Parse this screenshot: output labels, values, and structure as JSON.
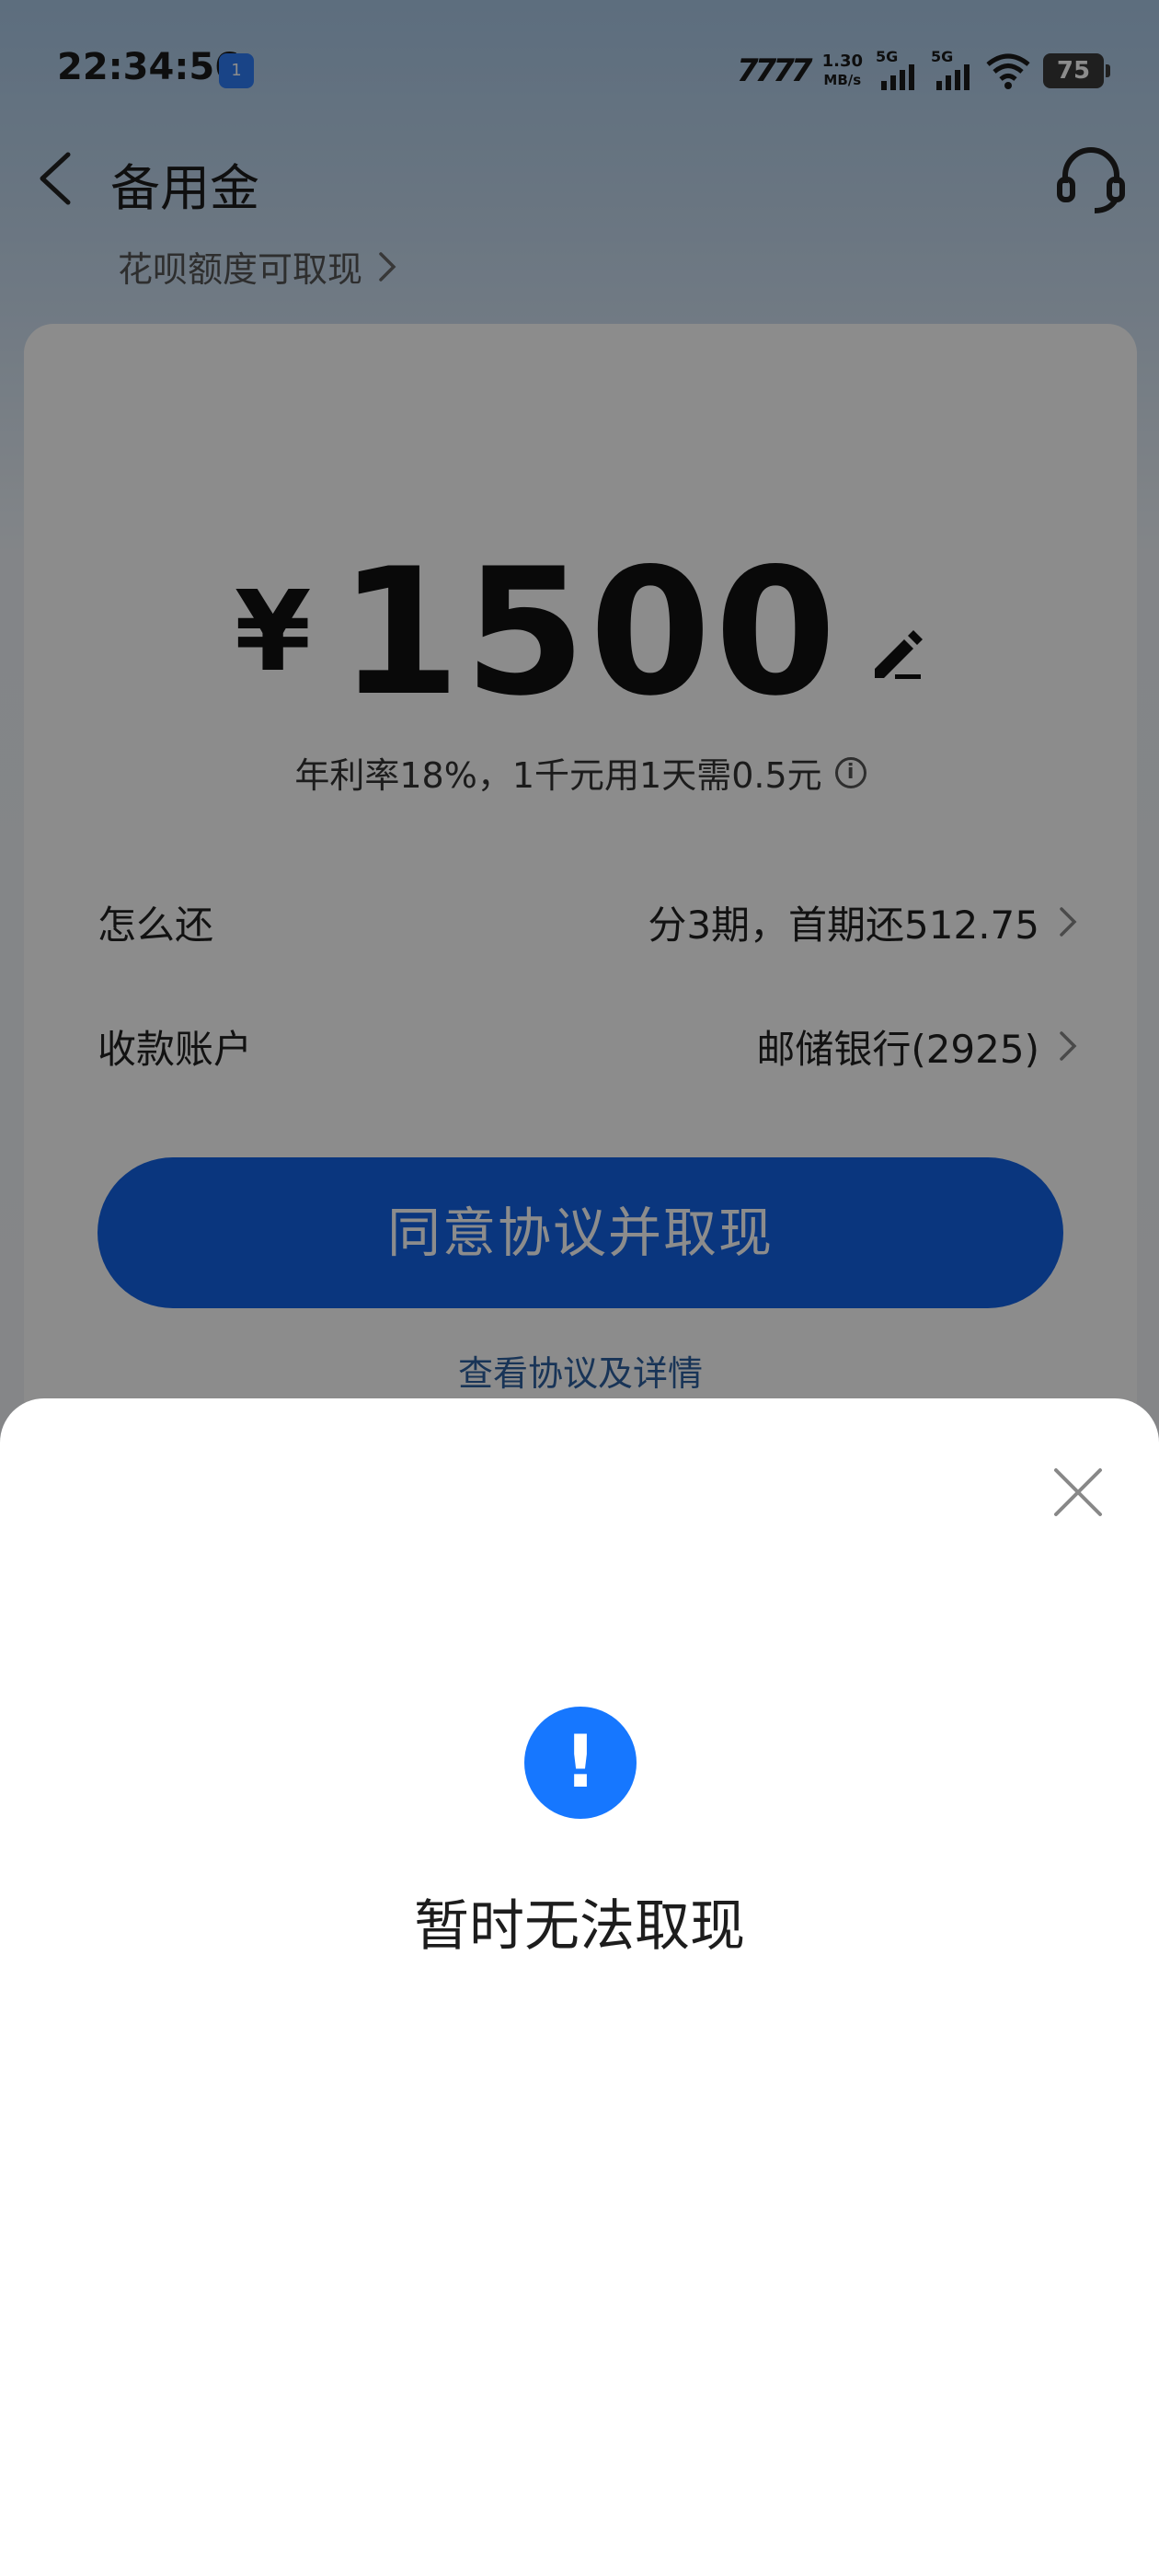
{
  "status": {
    "time": "22:34:56",
    "hotspot_badge": "1",
    "carrier_logo": "7777",
    "net_speed": "1.30",
    "net_speed_unit": "MB/s",
    "signal1_tag": "5G",
    "signal2_tag": "5G",
    "battery": "75"
  },
  "nav": {
    "title": "备用金",
    "sub_link": "花呗额度可取现"
  },
  "card": {
    "currency": "¥",
    "amount": "1500",
    "rate_text": "年利率18%，1千元用1天需0.5元",
    "rows": [
      {
        "label": "怎么还",
        "value": "分3期，首期还512.75"
      },
      {
        "label": "收款账户",
        "value": "邮储银行(2925)"
      }
    ],
    "cta": "同意协议并取现",
    "agreement_link": "查看协议及详情"
  },
  "sheet": {
    "alert_symbol": "!",
    "title": "暂时无法取现"
  },
  "colors": {
    "primary": "#1677ff",
    "cta": "#1363e6",
    "link": "#2d5f9e"
  }
}
